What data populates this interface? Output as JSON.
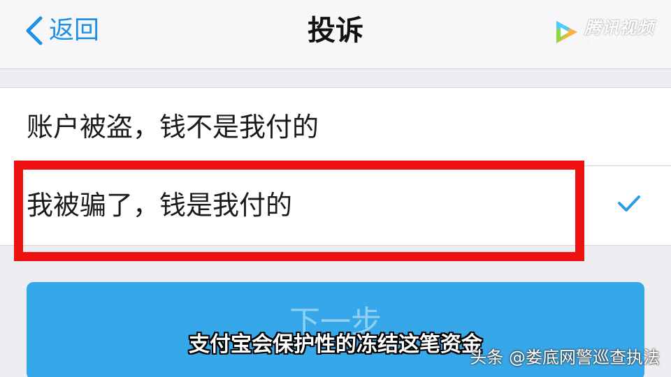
{
  "navbar": {
    "back_label": "返回",
    "title": "投诉",
    "logo_text": "腾讯视频"
  },
  "options": [
    {
      "label": "账户被盗，钱不是我付的",
      "selected": false
    },
    {
      "label": "我被骗了，钱是我付的",
      "selected": true
    }
  ],
  "next_button_label": "下一步",
  "caption": "支付宝会保护性的冻结这笔资金",
  "source_watermark": "头条 @娄底网警巡查执法",
  "colors": {
    "accent": "#1e90e6",
    "button": "#36a8ea",
    "highlight_box": "#ee1111",
    "checkmark": "#2a9be6"
  },
  "icons": {
    "back": "chevron-left-icon",
    "check": "checkmark-icon",
    "logo": "play-logo-icon"
  }
}
